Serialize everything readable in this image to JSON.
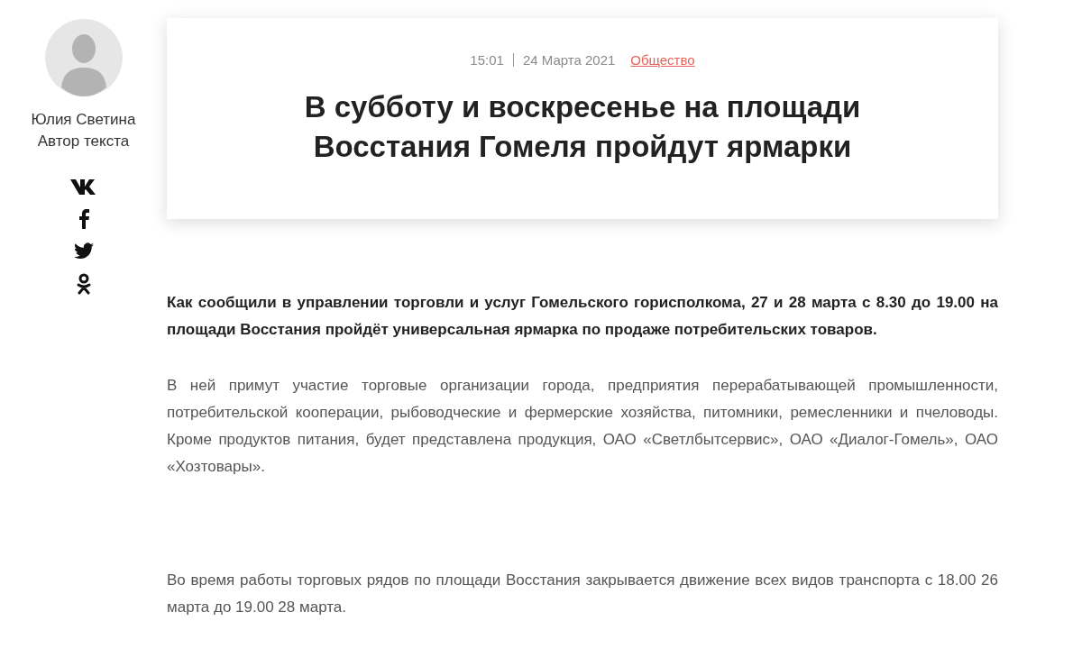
{
  "author": {
    "name": "Юлия Светина",
    "role": "Автор текста"
  },
  "article": {
    "time": "15:01",
    "date": "24 Марта 2021",
    "category": "Общество",
    "title": "В субботу и воскресенье на площади Восстания Гомеля пройдут ярмарки",
    "paragraphs": [
      {
        "kind": "lead",
        "text": "Как сообщили в управлении торговли и услуг Гомельского горисполкома, 27 и 28 марта с 8.30 до 19.00 на площади Восстания пройдёт универсальная ярмарка по продаже потребительских товаров."
      },
      {
        "kind": "body",
        "text": "В ней примут участие торговые организации города, предприятия перерабатывающей промышленности, потребительской кооперации, рыбоводческие и фермерские хозяйства, питомники, ремесленники и пчеловоды. Кроме продуктов питания, будет представлена продукция, ОАО «Светлбытсервис», ОАО «Диалог-Гомель», ОАО «Хозтовары»."
      },
      {
        "kind": "spacer"
      },
      {
        "kind": "body",
        "text": "Во время работы торговых рядов по площади Восстания закрывается движение всех видов транспорта с 18.00 26 марта до 19.00 28 марта."
      }
    ]
  }
}
